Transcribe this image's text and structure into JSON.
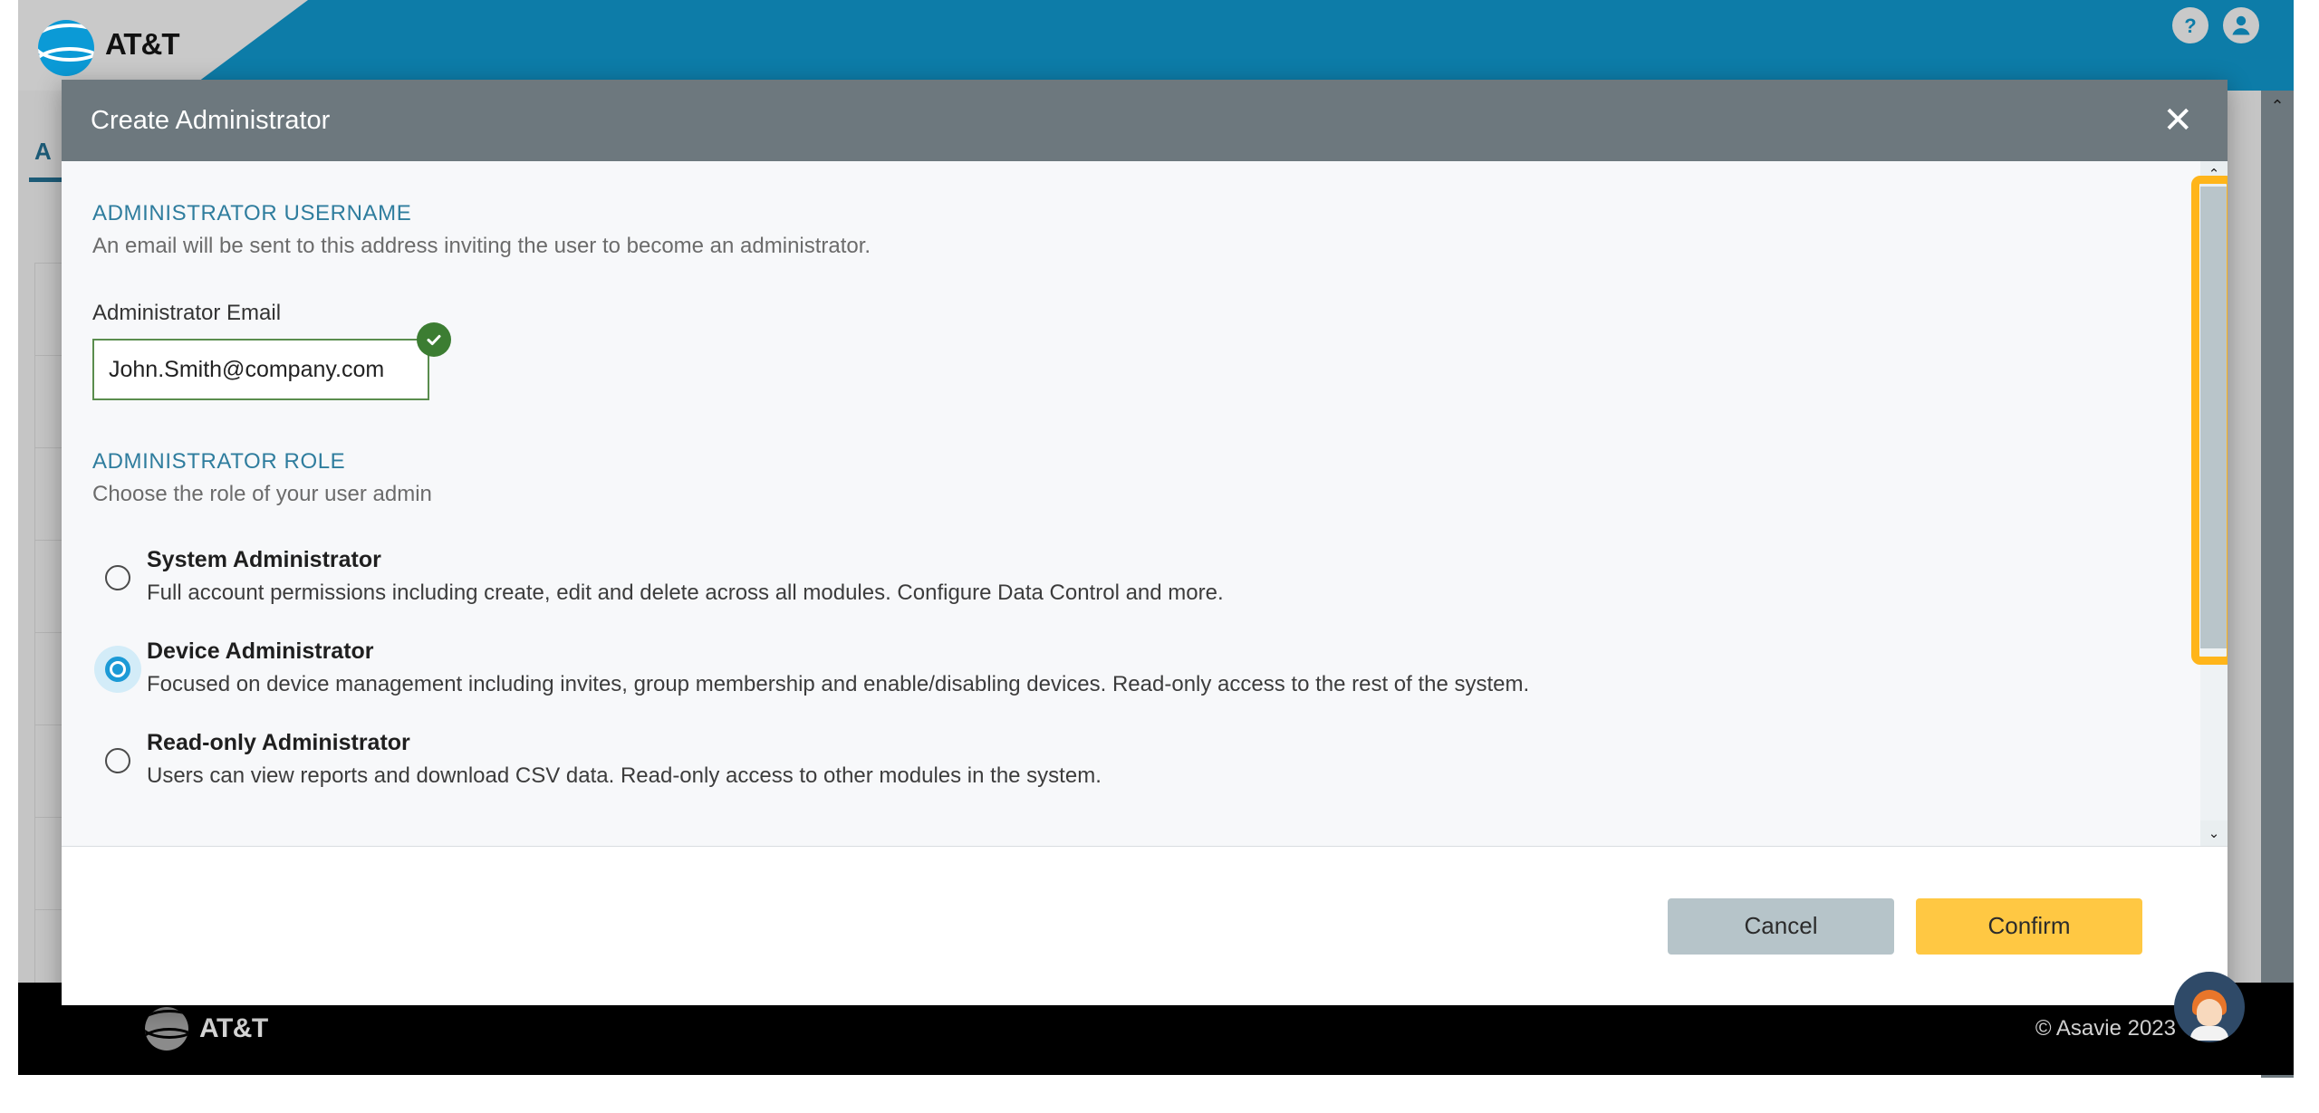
{
  "app": {
    "brand": "AT&T",
    "header_icons": [
      {
        "name": "help-icon",
        "glyph": "?"
      },
      {
        "name": "account-icon",
        "glyph": "person"
      }
    ],
    "background_tab_label": "A",
    "footer": {
      "brand": "AT&T",
      "copyright": "© Asavie 2023"
    }
  },
  "modal": {
    "title": "Create Administrator",
    "close_label": "✕",
    "username_section": {
      "heading": "ADMINISTRATOR USERNAME",
      "description": "An email will be sent to this address inviting the user to become an administrator.",
      "field_label": "Administrator Email",
      "email_value": "John.Smith@company.com",
      "email_placeholder": "Administrator Email",
      "valid": true,
      "valid_color": "#3c7d32"
    },
    "role_section": {
      "heading": "ADMINISTRATOR ROLE",
      "description": "Choose the role of your user admin",
      "selected": "Device Administrator",
      "options": [
        {
          "name": "System Administrator",
          "description": "Full account permissions including create, edit and delete across all modules. Configure Data Control and more.",
          "selected": false
        },
        {
          "name": "Device Administrator",
          "description": "Focused on device management including invites, group membership and enable/disabling devices. Read-only access to the rest of the system.",
          "selected": true
        },
        {
          "name": "Read-only Administrator",
          "description": "Users can view reports and download CSV data. Read-only access to other modules in the system.",
          "selected": false
        }
      ]
    },
    "footer": {
      "cancel_label": "Cancel",
      "confirm_label": "Confirm",
      "cancel_color": "#b6c4c9",
      "confirm_color": "#ffc843"
    },
    "scrollbar": {
      "up_arrow": "⌃",
      "down_arrow": "⌄",
      "highlighted": true,
      "highlight_color": "#ffb51a"
    }
  },
  "colors": {
    "header_blue": "#0d7ca8",
    "modal_header_gray": "#6d787e",
    "accent_teal": "#2f7d9e",
    "radio_blue": "#1c9ad6"
  }
}
